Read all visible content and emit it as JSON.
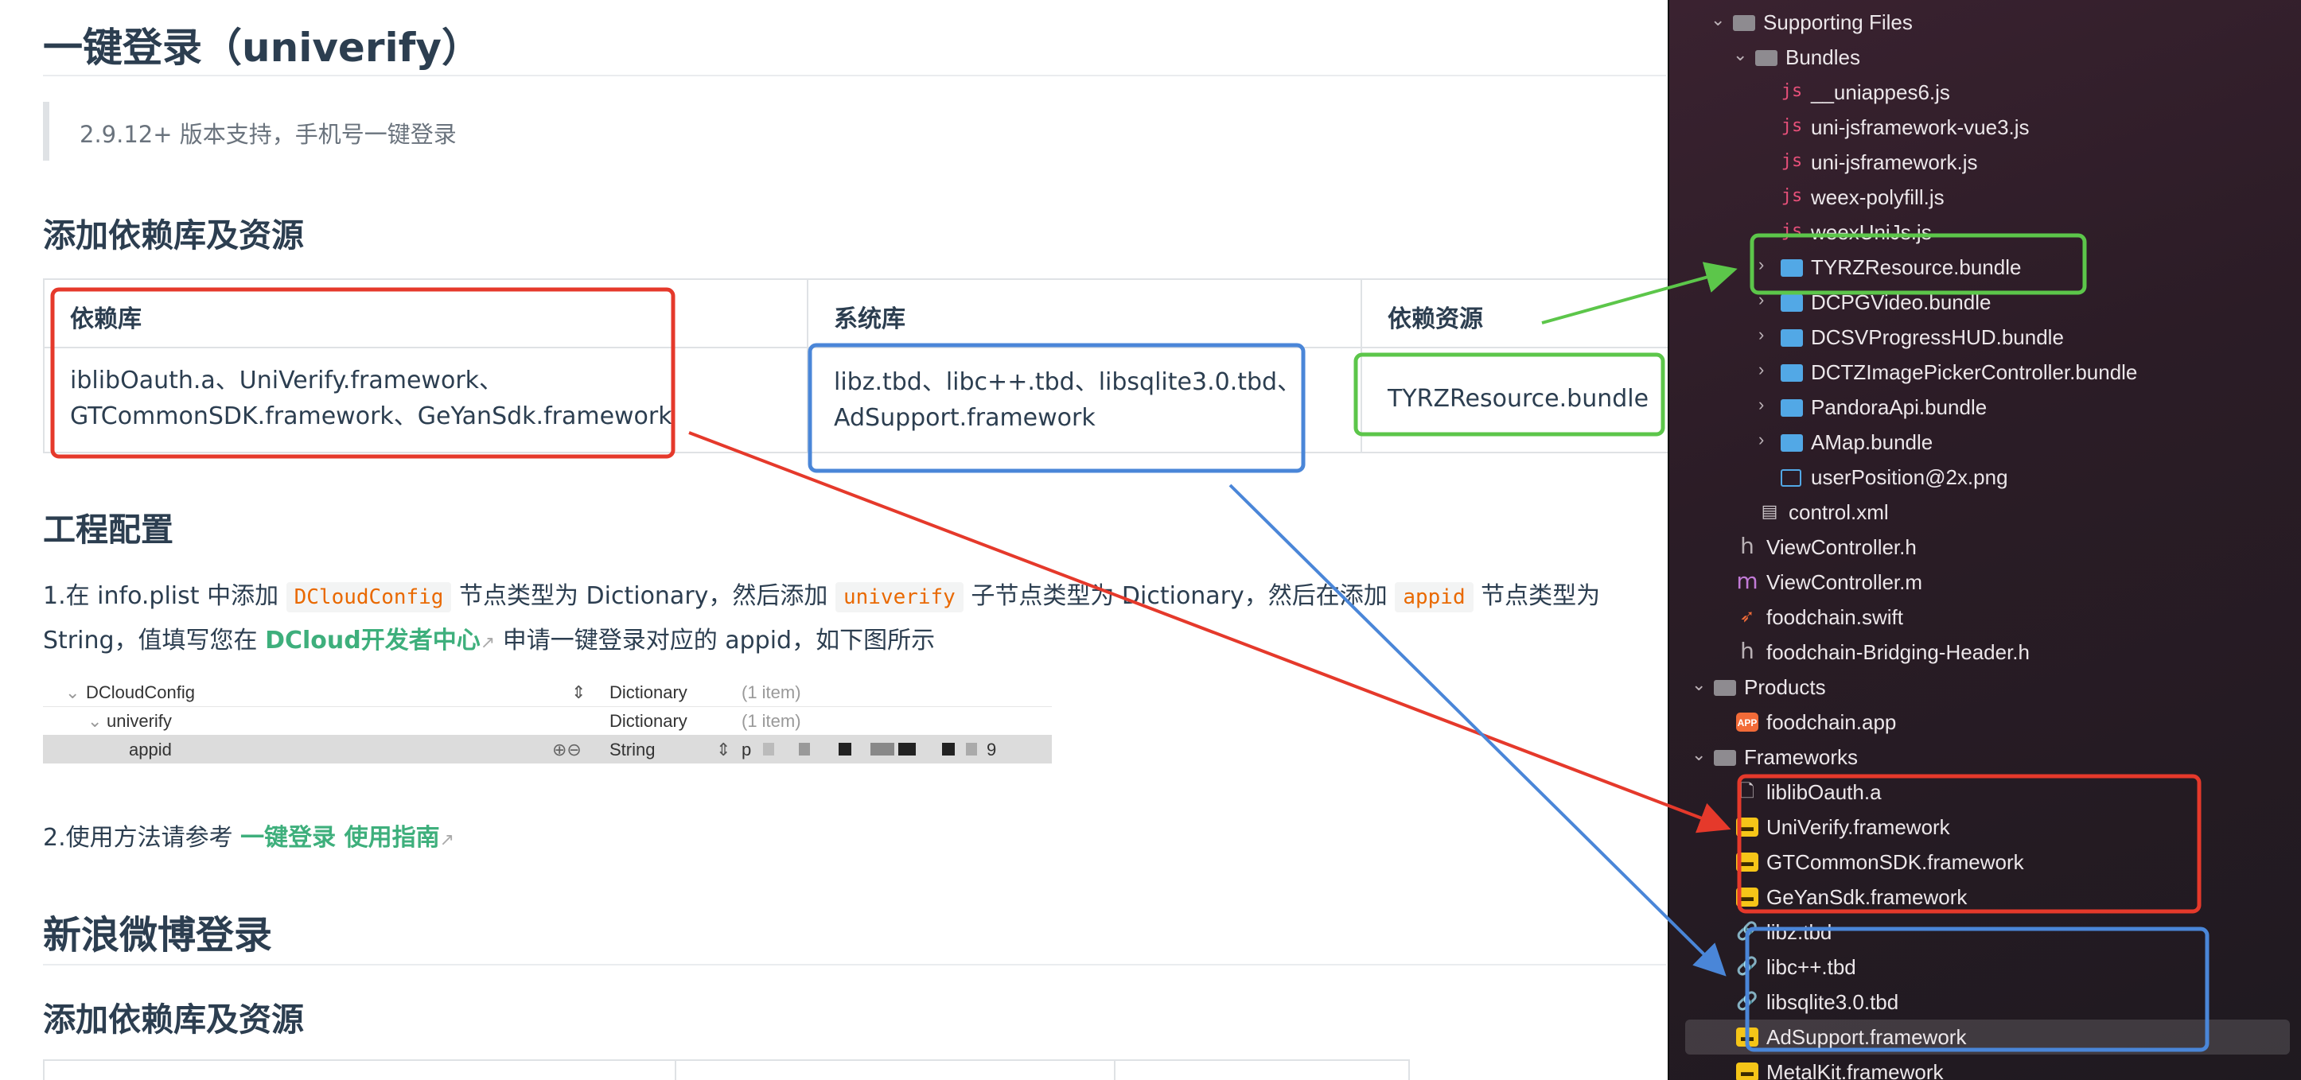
{
  "doc": {
    "title": "一键登录（univerify）",
    "quote": "2.9.12+ 版本支持，手机号一键登录",
    "section1_heading": "添加依赖库及资源",
    "table": {
      "headers": [
        "依赖库",
        "系统库",
        "依赖资源"
      ],
      "col1_line1": "iblibOauth.a、UniVerify.framework、",
      "col1_line2": "GTCommonSDK.framework、GeYanSdk.framework",
      "col2_line1": "libz.tbd、libc++.tbd、libsqlite3.0.tbd、",
      "col2_line2": "AdSupport.framework",
      "col3": "TYRZResource.bundle"
    },
    "section2_heading": "工程配置",
    "step1": {
      "t1": "1.在 info.plist 中添加 ",
      "code1": "DCloudConfig",
      "t2": " 节点类型为 Dictionary，然后添加 ",
      "code2": "univerify",
      "t3": " 子节点类型为 Dictionary，然后在添加 ",
      "code3": "appid",
      "t4": " 节点类型为",
      "line2_a": "String，值填写您在 ",
      "link": "DCloud开发者中心",
      "line2_b": " 申请一键登录对应的 appid，如下图所示"
    },
    "plist": {
      "rows": [
        {
          "key": "DCloudConfig",
          "type": "Dictionary",
          "value": "(1 item)"
        },
        {
          "key": "univerify",
          "type": "Dictionary",
          "value": "(1 item)"
        },
        {
          "key": "appid",
          "type": "String",
          "value_start": "p",
          "value_end": "9"
        }
      ]
    },
    "step2": {
      "text": "2.使用方法请参考 ",
      "link": "一键登录 使用指南"
    },
    "section3_heading": "新浪微博登录",
    "section4_heading": "添加依赖库及资源",
    "external_icon": "external-link-icon"
  },
  "navigator": {
    "items": [
      {
        "label": "Supporting Files",
        "icon": "folder-icon"
      },
      {
        "label": "Bundles",
        "icon": "folder-icon"
      },
      {
        "label": "__uniappes6.js",
        "icon": "js-file-icon"
      },
      {
        "label": "uni-jsframework-vue3.js",
        "icon": "js-file-icon"
      },
      {
        "label": "uni-jsframework.js",
        "icon": "js-file-icon"
      },
      {
        "label": "weex-polyfill.js",
        "icon": "js-file-icon"
      },
      {
        "label": "weexUniJs.js",
        "icon": "js-file-icon"
      },
      {
        "label": "TYRZResource.bundle",
        "icon": "bundle-icon"
      },
      {
        "label": "DCPGVideo.bundle",
        "icon": "bundle-icon"
      },
      {
        "label": "DCSVProgressHUD.bundle",
        "icon": "bundle-icon"
      },
      {
        "label": "DCTZImagePickerController.bundle",
        "icon": "bundle-icon"
      },
      {
        "label": "PandoraApi.bundle",
        "icon": "bundle-icon"
      },
      {
        "label": "AMap.bundle",
        "icon": "bundle-icon"
      },
      {
        "label": "userPosition@2x.png",
        "icon": "image-file-icon"
      },
      {
        "label": "control.xml",
        "icon": "xml-file-icon"
      },
      {
        "label": "ViewController.h",
        "icon": "header-file-icon"
      },
      {
        "label": "ViewController.m",
        "icon": "objc-file-icon"
      },
      {
        "label": "foodchain.swift",
        "icon": "swift-file-icon"
      },
      {
        "label": "foodchain-Bridging-Header.h",
        "icon": "header-file-icon"
      },
      {
        "label": "Products",
        "icon": "folder-icon"
      },
      {
        "label": "foodchain.app",
        "icon": "app-icon"
      },
      {
        "label": "Frameworks",
        "icon": "folder-icon"
      },
      {
        "label": "liblibOauth.a",
        "icon": "library-file-icon"
      },
      {
        "label": "UniVerify.framework",
        "icon": "framework-icon"
      },
      {
        "label": "GTCommonSDK.framework",
        "icon": "framework-icon"
      },
      {
        "label": "GeYanSdk.framework",
        "icon": "framework-icon"
      },
      {
        "label": "libz.tbd",
        "icon": "link-icon"
      },
      {
        "label": "libc++.tbd",
        "icon": "link-icon"
      },
      {
        "label": "libsqlite3.0.tbd",
        "icon": "link-icon"
      },
      {
        "label": "AdSupport.framework",
        "icon": "framework-icon"
      },
      {
        "label": "MetalKit.framework",
        "icon": "framework-icon"
      }
    ]
  },
  "annotation_colors": {
    "red": "#e5392b",
    "blue": "#4a86d8",
    "green": "#5cc64a"
  }
}
